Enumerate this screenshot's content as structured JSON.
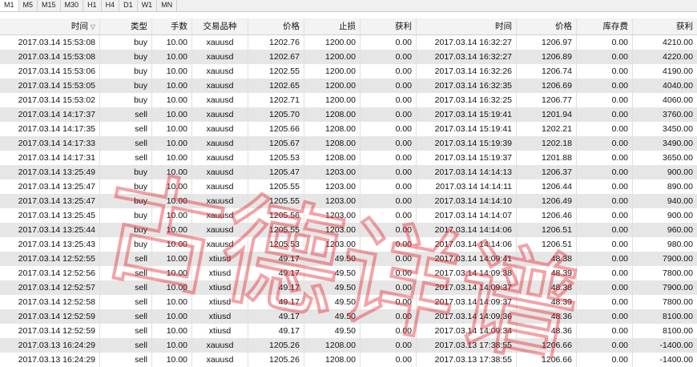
{
  "tabs": [
    "M1",
    "M5",
    "M15",
    "M30",
    "H1",
    "H4",
    "D1",
    "W1",
    "MN"
  ],
  "columns": [
    "时间",
    "类型",
    "手数",
    "交易品种",
    "价格",
    "止损",
    "获利",
    "时间",
    "价格",
    "库存费",
    "获利"
  ],
  "sort_icon": "▽",
  "rows": [
    [
      "2017.03.14 15:53:08",
      "buy",
      "10.00",
      "xauusd",
      "1202.76",
      "1200.00",
      "0.00",
      "2017.03.14 16:32:27",
      "1206.97",
      "0.00",
      "4210.00"
    ],
    [
      "2017.03.14 15:53:08",
      "buy",
      "10.00",
      "xauusd",
      "1202.67",
      "1200.00",
      "0.00",
      "2017.03.14 16:32:27",
      "1206.89",
      "0.00",
      "4220.00"
    ],
    [
      "2017.03.14 15:53:06",
      "buy",
      "10.00",
      "xauusd",
      "1202.55",
      "1200.00",
      "0.00",
      "2017.03.14 16:32:26",
      "1206.74",
      "0.00",
      "4190.00"
    ],
    [
      "2017.03.14 15:53:05",
      "buy",
      "10.00",
      "xauusd",
      "1202.65",
      "1200.00",
      "0.00",
      "2017.03.14 16:32:35",
      "1206.69",
      "0.00",
      "4040.00"
    ],
    [
      "2017.03.14 15:53:02",
      "buy",
      "10.00",
      "xauusd",
      "1202.71",
      "1200.00",
      "0.00",
      "2017.03.14 16:32:25",
      "1206.77",
      "0.00",
      "4060.00"
    ],
    [
      "2017.03.14 14:17:37",
      "sell",
      "10.00",
      "xauusd",
      "1205.70",
      "1208.00",
      "0.00",
      "2017.03.14 15:19:41",
      "1201.94",
      "0.00",
      "3760.00"
    ],
    [
      "2017.03.14 14:17:35",
      "sell",
      "10.00",
      "xauusd",
      "1205.66",
      "1208.00",
      "0.00",
      "2017.03.14 15:19:41",
      "1202.21",
      "0.00",
      "3450.00"
    ],
    [
      "2017.03.14 14:17:33",
      "sell",
      "10.00",
      "xauusd",
      "1205.67",
      "1208.00",
      "0.00",
      "2017.03.14 15:19:39",
      "1202.18",
      "0.00",
      "3490.00"
    ],
    [
      "2017.03.14 14:17:31",
      "sell",
      "10.00",
      "xauusd",
      "1205.53",
      "1208.00",
      "0.00",
      "2017.03.14 15:19:37",
      "1201.88",
      "0.00",
      "3650.00"
    ],
    [
      "2017.03.14 13:25:49",
      "buy",
      "10.00",
      "xauusd",
      "1205.47",
      "1203.00",
      "0.00",
      "2017.03.14 14:14:13",
      "1206.37",
      "0.00",
      "900.00"
    ],
    [
      "2017.03.14 13:25:47",
      "buy",
      "10.00",
      "xauusd",
      "1205.55",
      "1203.00",
      "0.00",
      "2017.03.14 14:14:11",
      "1206.44",
      "0.00",
      "890.00"
    ],
    [
      "2017.03.14 13:25:47",
      "buy",
      "10.00",
      "xauusd",
      "1205.55",
      "1203.00",
      "0.00",
      "2017.03.14 14:14:10",
      "1206.49",
      "0.00",
      "940.00"
    ],
    [
      "2017.03.14 13:25:45",
      "buy",
      "10.00",
      "xauusd",
      "1205.56",
      "1203.00",
      "0.00",
      "2017.03.14 14:14:07",
      "1206.46",
      "0.00",
      "900.00"
    ],
    [
      "2017.03.14 13:25:44",
      "buy",
      "10.00",
      "xauusd",
      "1205.55",
      "1203.00",
      "0.00",
      "2017.03.14 14:14:06",
      "1206.51",
      "0.00",
      "960.00"
    ],
    [
      "2017.03.14 13:25:43",
      "buy",
      "10.00",
      "xauusd",
      "1205.53",
      "1203.00",
      "0.00",
      "2017.03.14 14:14:06",
      "1206.51",
      "0.00",
      "980.00"
    ],
    [
      "2017.03.14 12:52:55",
      "sell",
      "10.00",
      "xtiusd",
      "49.17",
      "49.50",
      "0.00",
      "2017.03.14 14:09:41",
      "48.38",
      "0.00",
      "7900.00"
    ],
    [
      "2017.03.14 12:52:56",
      "sell",
      "10.00",
      "xtiusd",
      "49.17",
      "49.50",
      "0.00",
      "2017.03.14 14:09:38",
      "48.39",
      "0.00",
      "7800.00"
    ],
    [
      "2017.03.14 12:52:57",
      "sell",
      "10.00",
      "xtiusd",
      "49.17",
      "49.50",
      "0.00",
      "2017.03.14 14:09:37",
      "48.38",
      "0.00",
      "7900.00"
    ],
    [
      "2017.03.14 12:52:58",
      "sell",
      "10.00",
      "xtiusd",
      "49.17",
      "49.50",
      "0.00",
      "2017.03.14 14:09:37",
      "48.39",
      "0.00",
      "7800.00"
    ],
    [
      "2017.03.14 12:52:59",
      "sell",
      "10.00",
      "xtiusd",
      "49.17",
      "49.50",
      "0.00",
      "2017.03.14 14:09:36",
      "48.36",
      "0.00",
      "8100.00"
    ],
    [
      "2017.03.14 12:52:59",
      "sell",
      "10.00",
      "xtiusd",
      "49.17",
      "49.50",
      "0.00",
      "2017.03.14 14:09:34",
      "48.36",
      "0.00",
      "8100.00"
    ],
    [
      "2017.03.13 16:24:29",
      "sell",
      "10.00",
      "xauusd",
      "1205.26",
      "1208.00",
      "0.00",
      "2017.03.13 17:38:55",
      "1206.66",
      "0.00",
      "-1400.00"
    ],
    [
      "2017.03.13 16:24:29",
      "sell",
      "10.00",
      "xauusd",
      "1205.26",
      "1208.00",
      "0.00",
      "2017.03.13 17:38:55",
      "1206.66",
      "0.00",
      "-1400.00"
    ]
  ],
  "watermark": {
    "text": "古德详谱",
    "color": "#e8323c"
  }
}
